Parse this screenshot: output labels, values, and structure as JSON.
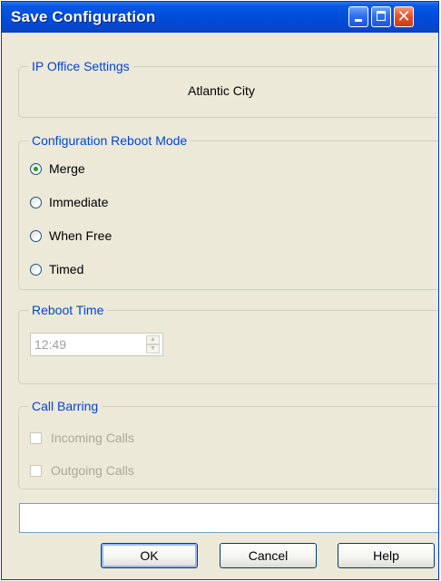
{
  "window": {
    "title": "Save Configuration"
  },
  "ip_office": {
    "legend": "IP Office Settings",
    "site": "Atlantic City"
  },
  "reboot_mode": {
    "legend": "Configuration Reboot Mode",
    "selected": "Merge",
    "options": [
      "Merge",
      "Immediate",
      "When Free",
      "Timed"
    ]
  },
  "reboot_time": {
    "legend": "Reboot Time",
    "value": "12:49",
    "enabled": false
  },
  "call_barring": {
    "legend": "Call Barring",
    "incoming_label": "Incoming Calls",
    "outgoing_label": "Outgoing Calls",
    "incoming_checked": false,
    "outgoing_checked": false,
    "enabled": false
  },
  "status": {
    "text": ""
  },
  "buttons": {
    "ok": "OK",
    "cancel": "Cancel",
    "help": "Help"
  },
  "colors": {
    "title_bar": "#0052e0",
    "group_legend": "#0046d5",
    "dialog_background": "#ece9d8",
    "disabled_text": "#aca899"
  }
}
